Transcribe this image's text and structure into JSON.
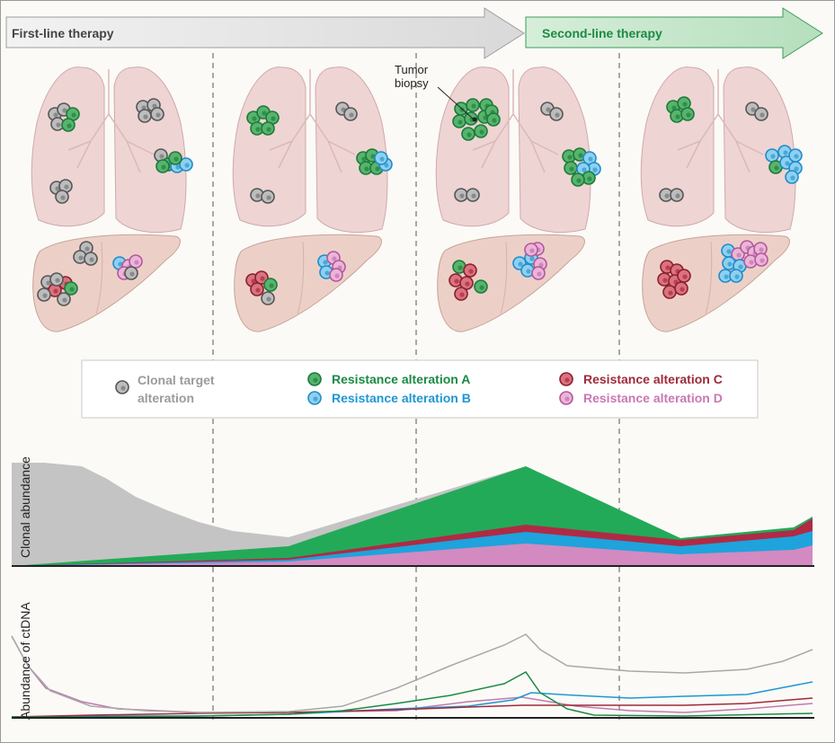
{
  "phases": {
    "first_line": "First-line therapy",
    "second_line": "Second-line therapy"
  },
  "annotation": {
    "tumor_biopsy_line1": "Tumor",
    "tumor_biopsy_line2": "biopsy"
  },
  "legend": {
    "clonal": {
      "line1": "Clonal target",
      "line2": "alteration",
      "color": "#a6a6a6"
    },
    "resistance_a": {
      "label": "Resistance alteration A",
      "color": "#1a9a4a"
    },
    "resistance_b": {
      "label": "Resistance alteration B",
      "color": "#1ea3dc"
    },
    "resistance_c": {
      "label": "Resistance alteration C",
      "color": "#a52a3a"
    },
    "resistance_d": {
      "label": "Resistance alteration D",
      "color": "#d07ab5"
    }
  },
  "axes": {
    "clonal_abundance": "Clonal abundance",
    "ctdna_abundance": "Abundance of ctDNA"
  },
  "colors": {
    "first_line_arrow": "#e6e6e6",
    "second_line_arrow": "#cfe9d5",
    "lung": "#efd3d3",
    "liver": "#ecd0c8"
  }
}
